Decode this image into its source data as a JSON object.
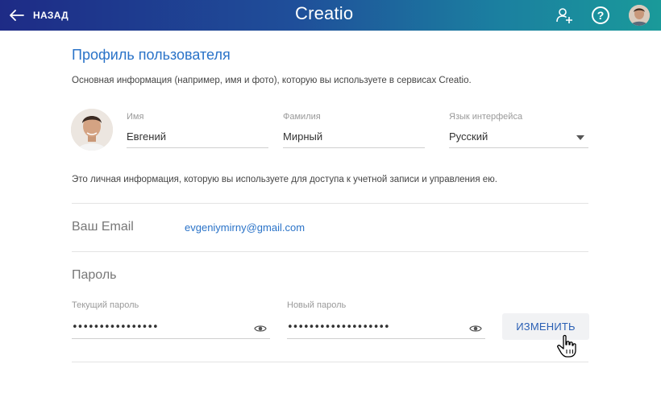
{
  "header": {
    "back_label": "НАЗАД",
    "logo_text": "Creatio",
    "gradient_colors": [
      "#1e2b86",
      "#1f4f9a",
      "#1b7fa0",
      "#1a9a9a"
    ],
    "icons": [
      "arrow-left-icon",
      "add-user-icon",
      "help-icon",
      "user-avatar"
    ]
  },
  "profile": {
    "title": "Профиль пользователя",
    "intro": "Основная информация (например, имя и фото), которую вы используете в сервисах Creatio.",
    "fields": {
      "first_name": {
        "label": "Имя",
        "value": "Евгений"
      },
      "last_name": {
        "label": "Фамилия",
        "value": "Мирный"
      },
      "language": {
        "label": "Язык интерфейса",
        "value": "Русский"
      }
    }
  },
  "account": {
    "info": "Это личная информация, которую вы используете для доступа к учетной записи и управления ею.",
    "email_label": "Ваш Email",
    "email_value": "evgeniymirny@gmail.com"
  },
  "password": {
    "title": "Пароль",
    "current_label": "Текущий пароль",
    "current_value": "••••••••••••••••",
    "new_label": "Новый пароль",
    "new_value": "•••••••••••••••••••",
    "change_button": "ИЗМЕНИТЬ"
  },
  "colors": {
    "accent": "#2a73c8",
    "button_text": "#2a5fb4",
    "button_bg": "#f1f2f4"
  }
}
